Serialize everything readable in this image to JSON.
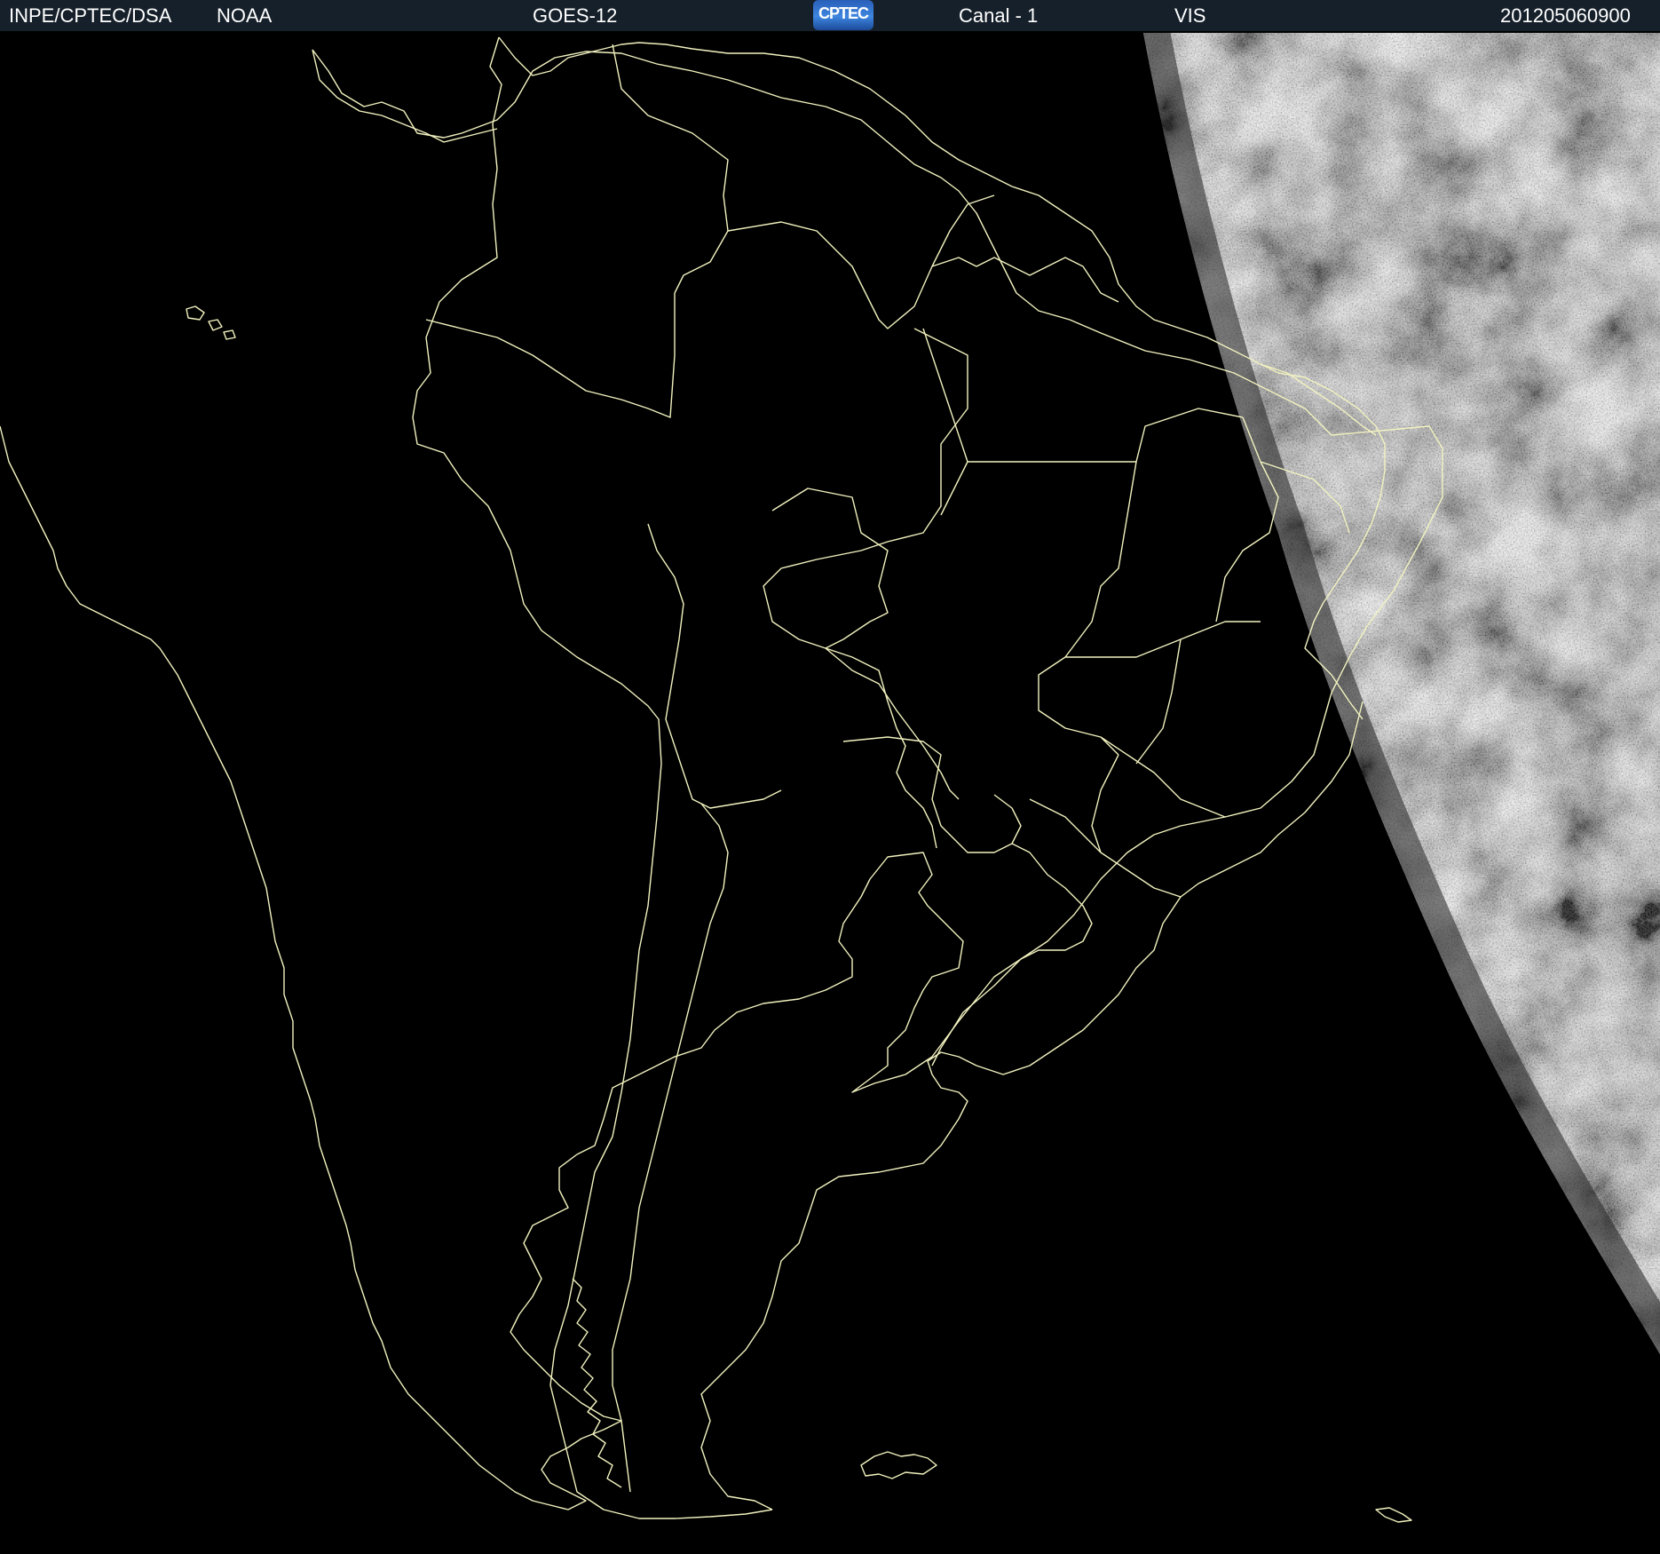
{
  "header": {
    "agency": "INPE/CPTEC/DSA",
    "provider": "NOAA",
    "satellite": "GOES-12",
    "logo_text": "CPTEC",
    "channel": "Canal - 1",
    "band": "VIS",
    "timestamp": "201205060900"
  },
  "map": {
    "background_color": "#000000",
    "border_color": "#f2f2c0",
    "header_bg": "#16202a"
  }
}
